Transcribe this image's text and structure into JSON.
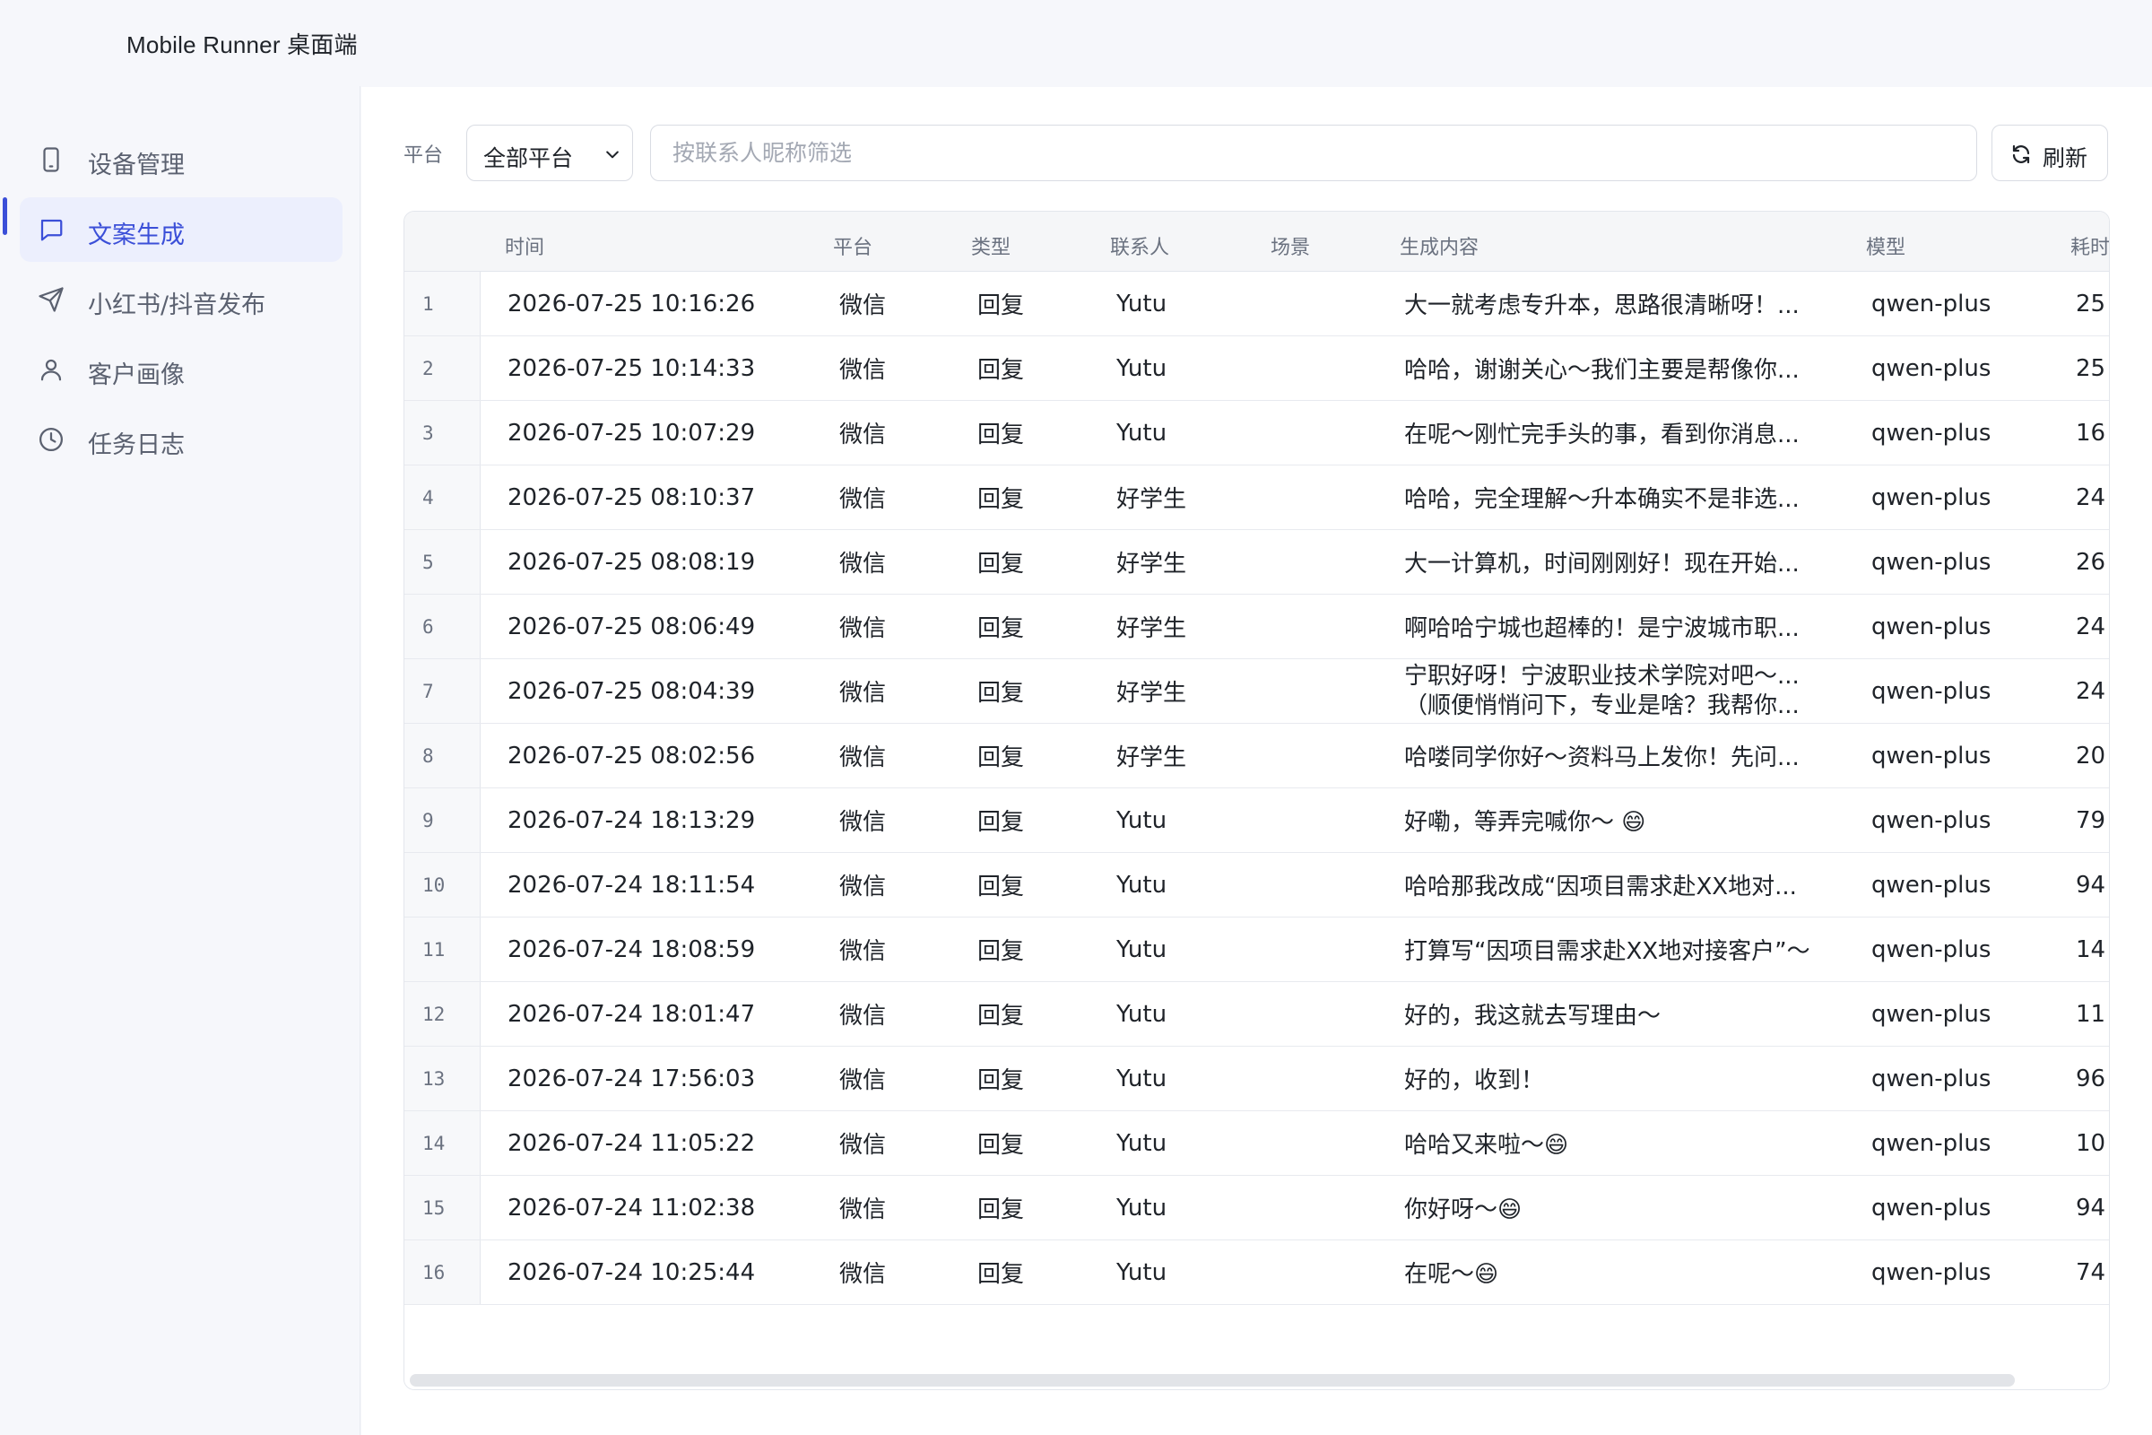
{
  "app": {
    "title": "Mobile Runner 桌面端"
  },
  "sidebar": {
    "items": [
      {
        "label": "设备管理",
        "icon": "phone-icon",
        "active": false
      },
      {
        "label": "文案生成",
        "icon": "chat-icon",
        "active": true
      },
      {
        "label": "小红书/抖音发布",
        "icon": "send-icon",
        "active": false
      },
      {
        "label": "客户画像",
        "icon": "user-icon",
        "active": false
      },
      {
        "label": "任务日志",
        "icon": "clock-icon",
        "active": false
      }
    ]
  },
  "filters": {
    "platform_label": "平台",
    "platform_value": "全部平台",
    "search_placeholder": "按联系人昵称筛选",
    "refresh_label": "刷新"
  },
  "table": {
    "columns": [
      "时间",
      "平台",
      "类型",
      "联系人",
      "场景",
      "生成内容",
      "模型",
      "耗时"
    ],
    "rows": [
      {
        "n": "1",
        "time": "2026-07-25 10:16:26",
        "platform": "微信",
        "type": "回复",
        "contact": "Yutu",
        "content": "大一就考虑专升本，思路很清晰呀！...",
        "model": "qwen-plus",
        "cost": "25"
      },
      {
        "n": "2",
        "time": "2026-07-25 10:14:33",
        "platform": "微信",
        "type": "回复",
        "contact": "Yutu",
        "content": "哈哈，谢谢关心～我们主要是帮像你...",
        "model": "qwen-plus",
        "cost": "25"
      },
      {
        "n": "3",
        "time": "2026-07-25 10:07:29",
        "platform": "微信",
        "type": "回复",
        "contact": "Yutu",
        "content": "在呢～刚忙完手头的事，看到你消息...",
        "model": "qwen-plus",
        "cost": "16"
      },
      {
        "n": "4",
        "time": "2026-07-25 08:10:37",
        "platform": "微信",
        "type": "回复",
        "contact": "好学生",
        "content": "哈哈，完全理解～升本确实不是非选...",
        "model": "qwen-plus",
        "cost": "24"
      },
      {
        "n": "5",
        "time": "2026-07-25 08:08:19",
        "platform": "微信",
        "type": "回复",
        "contact": "好学生",
        "content": "大一计算机，时间刚刚好！现在开始...",
        "model": "qwen-plus",
        "cost": "26"
      },
      {
        "n": "6",
        "time": "2026-07-25 08:06:49",
        "platform": "微信",
        "type": "回复",
        "contact": "好学生",
        "content": "啊哈哈宁城也超棒的！是宁波城市职...",
        "model": "qwen-plus",
        "cost": "24"
      },
      {
        "n": "7",
        "time": "2026-07-25 08:04:39",
        "platform": "微信",
        "type": "回复",
        "contact": "好学生",
        "content": "宁职好呀！宁波职业技术学院对吧～...",
        "content2": "（顺便悄悄问下，专业是啥？我帮你...",
        "model": "qwen-plus",
        "cost": "24"
      },
      {
        "n": "8",
        "time": "2026-07-25 08:02:56",
        "platform": "微信",
        "type": "回复",
        "contact": "好学生",
        "content": "哈喽同学你好～资料马上发你！先问...",
        "model": "qwen-plus",
        "cost": "20"
      },
      {
        "n": "9",
        "time": "2026-07-24 18:13:29",
        "platform": "微信",
        "type": "回复",
        "contact": "Yutu",
        "content": "好嘞，等弄完喊你～ 😄",
        "model": "qwen-plus",
        "cost": "79"
      },
      {
        "n": "10",
        "time": "2026-07-24 18:11:54",
        "platform": "微信",
        "type": "回复",
        "contact": "Yutu",
        "content": "哈哈那我改成“因项目需求赴XX地对...",
        "model": "qwen-plus",
        "cost": "94"
      },
      {
        "n": "11",
        "time": "2026-07-24 18:08:59",
        "platform": "微信",
        "type": "回复",
        "contact": "Yutu",
        "content": "打算写“因项目需求赴XX地对接客户”～",
        "model": "qwen-plus",
        "cost": "14"
      },
      {
        "n": "12",
        "time": "2026-07-24 18:01:47",
        "platform": "微信",
        "type": "回复",
        "contact": "Yutu",
        "content": "好的，我这就去写理由～",
        "model": "qwen-plus",
        "cost": "11"
      },
      {
        "n": "13",
        "time": "2026-07-24 17:56:03",
        "platform": "微信",
        "type": "回复",
        "contact": "Yutu",
        "content": "好的，收到！",
        "model": "qwen-plus",
        "cost": "96"
      },
      {
        "n": "14",
        "time": "2026-07-24 11:05:22",
        "platform": "微信",
        "type": "回复",
        "contact": "Yutu",
        "content": "哈哈又来啦～😄",
        "model": "qwen-plus",
        "cost": "10"
      },
      {
        "n": "15",
        "time": "2026-07-24 11:02:38",
        "platform": "微信",
        "type": "回复",
        "contact": "Yutu",
        "content": "你好呀～😄",
        "model": "qwen-plus",
        "cost": "94"
      },
      {
        "n": "16",
        "time": "2026-07-24 10:25:44",
        "platform": "微信",
        "type": "回复",
        "contact": "Yutu",
        "content": "在呢～😄",
        "model": "qwen-plus",
        "cost": "74"
      }
    ]
  },
  "colors": {
    "accent": "#3b4fd8",
    "active_bg": "#eceffd",
    "header_bg": "#f5f6f8",
    "app_bg": "#f6f7fb"
  }
}
